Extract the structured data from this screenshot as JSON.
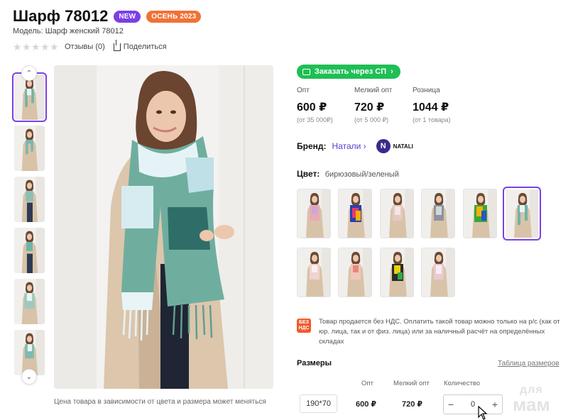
{
  "product": {
    "title": "Шарф 78012",
    "badges": [
      "NEW",
      "ОСЕНЬ 2023"
    ],
    "model": "Модель: Шарф женский 78012",
    "reviews": "Отзывы (0)",
    "share": "Поделиться",
    "rating_stars": 0,
    "photo_caption": "Цена товара в зависимости от цвета и размера может меняться"
  },
  "order_sp_button": "Заказать через СП",
  "prices": [
    {
      "label": "Опт",
      "value": "600 ₽",
      "note": "(от 35 000₽)"
    },
    {
      "label": "Мелкий опт",
      "value": "720 ₽",
      "note": "(от 5 000 ₽)"
    },
    {
      "label": "Розница",
      "value": "1044 ₽",
      "note": "(от 1 товара)"
    }
  ],
  "brand": {
    "label": "Бренд:",
    "name": "Натали",
    "logo_text": "NATALI"
  },
  "color": {
    "label": "Цвет:",
    "value": "бирюзовый/зеленый",
    "selected_index": 5
  },
  "vat": {
    "icon_text": "БЕЗ НДС",
    "text": "Товар продается без НДС. Оплатить такой товар можно только на р/с (как от юр. лица, так и от физ. лица) или за наличный расчёт на определённых складах"
  },
  "sizes": {
    "title": "Размеры",
    "size_table_link": "Таблица размеров",
    "columns": [
      "Опт",
      "Мелкий опт",
      "Количество"
    ],
    "rows": [
      {
        "size": "190*70",
        "opt": "600 ₽",
        "small_opt": "720 ₽",
        "quantity": "0"
      }
    ]
  },
  "icons": {
    "minus": "−",
    "plus": "+",
    "chevron_up": "⌃",
    "chevron_down": "⌄"
  },
  "watermark": {
    "top": "для",
    "bottom": "мам"
  },
  "colors": {
    "accent_purple": "#7b3fe4",
    "accent_orange": "#f07236",
    "sp_green": "#1ebf54"
  }
}
